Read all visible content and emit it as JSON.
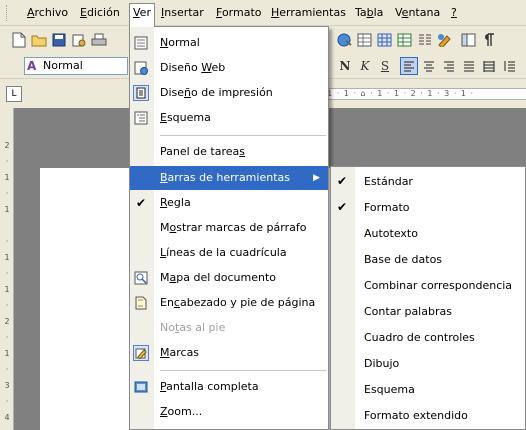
{
  "menubar": {
    "items": [
      {
        "pre": "",
        "u": "A",
        "post": "rchivo"
      },
      {
        "pre": "",
        "u": "E",
        "post": "dición"
      },
      {
        "pre": "",
        "u": "V",
        "post": "er"
      },
      {
        "pre": "",
        "u": "I",
        "post": "nsertar"
      },
      {
        "pre": "",
        "u": "F",
        "post": "ormato"
      },
      {
        "pre": "",
        "u": "H",
        "post": "erramientas"
      },
      {
        "pre": "Ta",
        "u": "b",
        "post": "la"
      },
      {
        "pre": "V",
        "u": "e",
        "post": "ntana"
      },
      {
        "pre": "",
        "u": "?",
        "post": ""
      }
    ]
  },
  "formatting_toolbar": {
    "style_value": "Normal",
    "bold": "N",
    "italic": "K",
    "underline": "S"
  },
  "ruler": {
    "tab_selector": "L",
    "scale": "· 1 · 1 · ⌂ · 1 · 1 · 2 · 1 · 3 · 1 ·"
  },
  "vruler": {
    "scale": "2\n·\n1\n·\n1\n\n·\n1\n·\n1\n·\n2\n·\n1\n·\n3\n·\n4"
  },
  "ver_menu": {
    "items": [
      {
        "pre": "",
        "u": "N",
        "post": "ormal",
        "icon": "normal-view-icon"
      },
      {
        "pre": "Diseño ",
        "u": "W",
        "post": "eb",
        "icon": "web-layout-icon"
      },
      {
        "pre": "Dise",
        "u": "ñ",
        "post": "o de impresión",
        "icon": "print-layout-icon"
      },
      {
        "pre": "",
        "u": "E",
        "post": "squema",
        "icon": "outline-view-icon"
      },
      {
        "pre": "Panel de tarea",
        "u": "s",
        "post": ""
      },
      {
        "pre": "",
        "u": "B",
        "post": "arras de herramientas"
      },
      {
        "pre": "",
        "u": "R",
        "post": "egla"
      },
      {
        "pre": "M",
        "u": "o",
        "post": "strar marcas de párrafo"
      },
      {
        "pre": "",
        "u": "L",
        "post": "íneas de la cuadrícula"
      },
      {
        "pre": "M",
        "u": "a",
        "post": "pa del documento",
        "icon": "document-map-icon"
      },
      {
        "pre": "En",
        "u": "c",
        "post": "abezado y pie de página",
        "icon": "header-footer-icon"
      },
      {
        "pre": "No",
        "u": "t",
        "post": "as al pie"
      },
      {
        "pre": "",
        "u": "M",
        "post": "arcas",
        "icon": "markup-icon"
      },
      {
        "pre": "",
        "u": "P",
        "post": "antalla completa",
        "icon": "full-screen-icon"
      },
      {
        "pre": "",
        "u": "Z",
        "post": "oom..."
      }
    ]
  },
  "toolbars_submenu": {
    "items": [
      {
        "label": "Estándar",
        "checked": true
      },
      {
        "label": "Formato",
        "checked": true
      },
      {
        "label": "Autotexto",
        "checked": false
      },
      {
        "label": "Base de datos",
        "checked": false
      },
      {
        "label": "Combinar correspondencia",
        "checked": false
      },
      {
        "label": "Contar palabras",
        "checked": false
      },
      {
        "label": "Cuadro de controles",
        "checked": false
      },
      {
        "label": "Dibujo",
        "checked": false
      },
      {
        "label": "Esquema",
        "checked": false
      },
      {
        "label": "Formato extendido",
        "checked": false
      }
    ]
  },
  "colors": {
    "highlight": "#316ac5",
    "menu_bg": "#ffffff",
    "chrome": "#ece9d8"
  }
}
